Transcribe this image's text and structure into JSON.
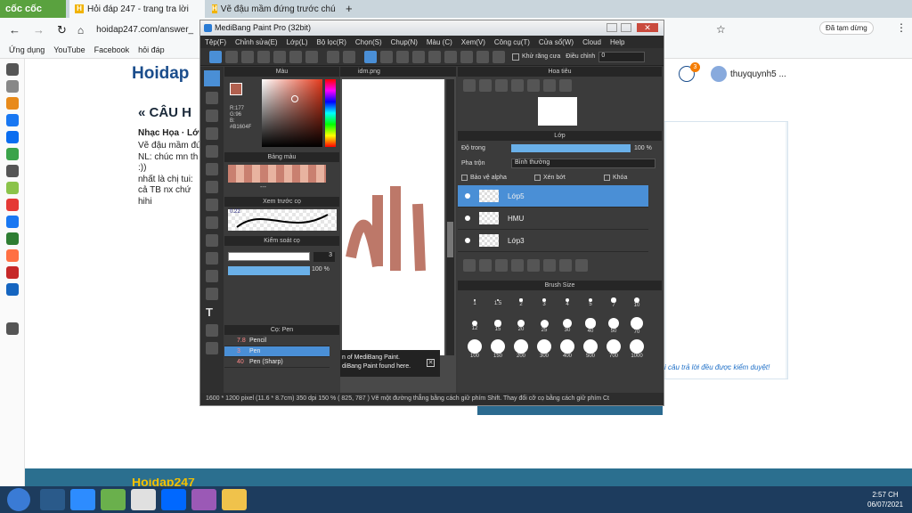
{
  "browser": {
    "brand": "cốc cốc",
    "tabs": [
      "Hỏi đáp 247 - trang tra lời",
      "Vẽ đậu mầm đứng trước chú"
    ],
    "url": "hoidap247.com/answer_",
    "signed_in": "Đã tạm dừng",
    "bookmarks": [
      "Ứng dụng",
      "YouTube",
      "Facebook",
      "hỏi đáp"
    ]
  },
  "site": {
    "logo": "Hoidap",
    "heading": "« CÂU H",
    "meta": "Nhạc Họa · Lớp",
    "lines": [
      "Vẽ đậu mầm đứ",
      "NL: chúc mn th",
      ":))",
      "nhất là chị tui:",
      "cả TB nx chứ",
      "hihi"
    ],
    "user": "thuyquynh5 ...",
    "notify": "3",
    "verified": "i câu trả lời đều được kiểm duyệt!",
    "footer_logo": "Hoidap247"
  },
  "app": {
    "title": "MediBang Paint Pro (32bit)",
    "menus": [
      "Tệp(F)",
      "Chỉnh sửa(E)",
      "Lớp(L)",
      "Bộ lọc(R)",
      "Chọn(S)",
      "Chụp(N)",
      "Màu (C)",
      "Xem(V)",
      "Công cụ(T)",
      "Cửa sổ(W)",
      "Cloud",
      "Help"
    ],
    "antialias": "Khử răng cưa",
    "adjust": "Điều chỉnh",
    "adjust_value": "0",
    "color_panel": "Màu",
    "rgb": [
      "R:177",
      "G:96",
      "B:"
    ],
    "hex": "#B1604F",
    "palette_panel": "Bảng màu",
    "palette_dash": "---",
    "preview_panel": "Xem trước cọ",
    "preview_value": "0.22",
    "brush_ctrl": "Kiểm soát cọ",
    "brush_size": "3",
    "opacity": "100 %",
    "pen_panel": "Cọ: Pen",
    "pens": [
      {
        "size": "7.8",
        "name": "Pencil"
      },
      {
        "size": "3",
        "name": "Pen"
      },
      {
        "size": "40",
        "name": "Pen (Sharp)"
      }
    ],
    "canvas_title": "idm.png",
    "toast_lines": [
      "n of MediBang Paint.",
      "diBang Paint found here."
    ],
    "nav_panel": "Hoa tiêu",
    "layer_panel": "Lớp",
    "opacity_label": "Độ trong",
    "layer_opacity": "100 %",
    "blend_label": "Pha trộn",
    "blend_value": "Bình thường",
    "checks": [
      "Bảo vệ alpha",
      "Xén bớt",
      "Khóa"
    ],
    "layers": [
      "Lớp5",
      "HMU",
      "Lớp3"
    ],
    "brushsize_panel": "Brush Size",
    "sizes": [
      "1",
      "1.5",
      "2",
      "3",
      "4",
      "5",
      "7",
      "10",
      "12",
      "15",
      "20",
      "25",
      "30",
      "40",
      "50",
      "70",
      "100",
      "150",
      "200",
      "300",
      "400",
      "500",
      "700",
      "1000"
    ],
    "status": "1600 * 1200 pixel  (11.6 * 8.7cm)  350 dpi  150 %  ( 825, 787 )  Vẽ một đường thẳng bằng cách giữ phím Shift. Thay đổi cỡ cọ bằng cách giữ phím Ct"
  },
  "taskbar": {
    "time": "2:57 CH",
    "date": "06/07/2021"
  }
}
